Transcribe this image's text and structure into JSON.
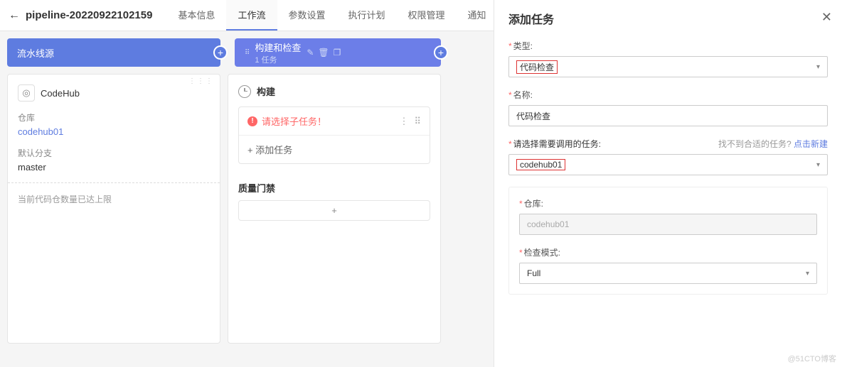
{
  "header": {
    "pipeline_name": "pipeline-20220922102159",
    "tabs": [
      "基本信息",
      "工作流",
      "参数设置",
      "执行计划",
      "权限管理",
      "通知"
    ],
    "active_tab": 1
  },
  "source_stage": {
    "title": "流水线源",
    "card": {
      "provider": "CodeHub",
      "repo_label": "仓库",
      "repo_value": "codehub01",
      "branch_label": "默认分支",
      "branch_value": "master",
      "limit_msg": "当前代码仓数量已达上限"
    }
  },
  "build_stage": {
    "title": "构建和检查",
    "sub": "1 任务",
    "card": {
      "title": "构建",
      "warn": "请选择子任务！",
      "add_task": "+  添加任务",
      "gate_title": "质量门禁",
      "gate_add": "+"
    }
  },
  "panel": {
    "title": "添加任务",
    "type_label": "类型:",
    "type_value": "代码检查",
    "name_label": "名称:",
    "name_value": "代码检查",
    "task_label": "请选择需要调用的任务:",
    "task_hint_prefix": "找不到合适的任务? ",
    "task_hint_link": "点击新建",
    "task_value": "codehub01",
    "repo_label": "仓库:",
    "repo_value": "codehub01",
    "mode_label": "检查模式:",
    "mode_value": "Full"
  },
  "watermark": "@51CTO博客"
}
